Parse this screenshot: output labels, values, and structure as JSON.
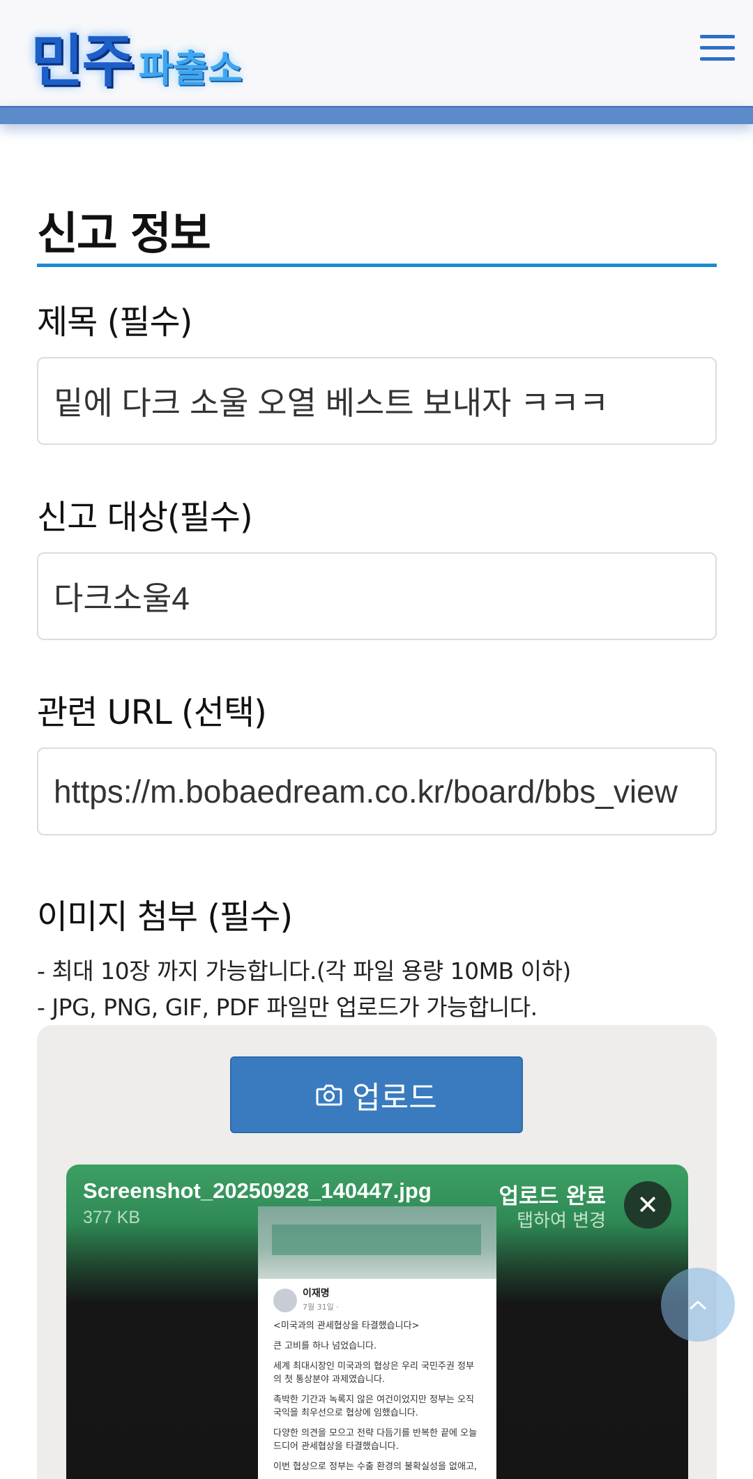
{
  "header": {
    "logo_main": "민주",
    "logo_sub": "파출소"
  },
  "form": {
    "section_title": "신고 정보",
    "title_label": "제목 (필수)",
    "title_value": "밑에 다크 소울 오열 베스트 보내자 ㅋㅋㅋ",
    "target_label": "신고 대상(필수)",
    "target_value": "다크소울4",
    "url_label": "관련 URL (선택)",
    "url_value": "https://m.bobaedream.co.kr/board/bbs_view",
    "image_label": "이미지 첨부 (필수)",
    "image_note_1": "- 최대 10장 까지 가능합니다.(각 파일 용량 10MB 이하)",
    "image_note_2": "- JPG, PNG, GIF, PDF 파일만 업로드가 가능합니다.",
    "upload_button": "업로드"
  },
  "file": {
    "name": "Screenshot_20250928_140447.jpg",
    "size": "377 KB",
    "status": "업로드 완료",
    "hint": "탭하여 변경",
    "remove": "✕",
    "preview": {
      "author": "이재명",
      "date": "7월 31일 · ",
      "headline": "<미국과의 관세협상을 타결했습니다>",
      "p1": "큰 고비를 하나 넘었습니다.",
      "p2": "세계 최대시장인 미국과의 협상은 우리 국민주권 정부의 첫 통상분야 과제였습니다.",
      "p3": "촉박한 기간과 녹록지 않은 여건이었지만 정부는 오직 국익을 최우선으로 협상에 임했습니다.",
      "p4": "다양한 의견을 모으고 전략 다듬기를 반복한 끝에 오늘 드디어 관세협상을 타결했습니다.",
      "p5": "이번 협상으로 정부는 수출 환경의 불확실성을 없애고,"
    }
  },
  "icons": {
    "menu": "hamburger-menu-icon",
    "camera": "camera-icon",
    "scroll_top": "chevron-up-icon"
  },
  "colors": {
    "accent": "#1f8ad0",
    "button": "#3a7bbf",
    "card_green": "#3da063"
  }
}
